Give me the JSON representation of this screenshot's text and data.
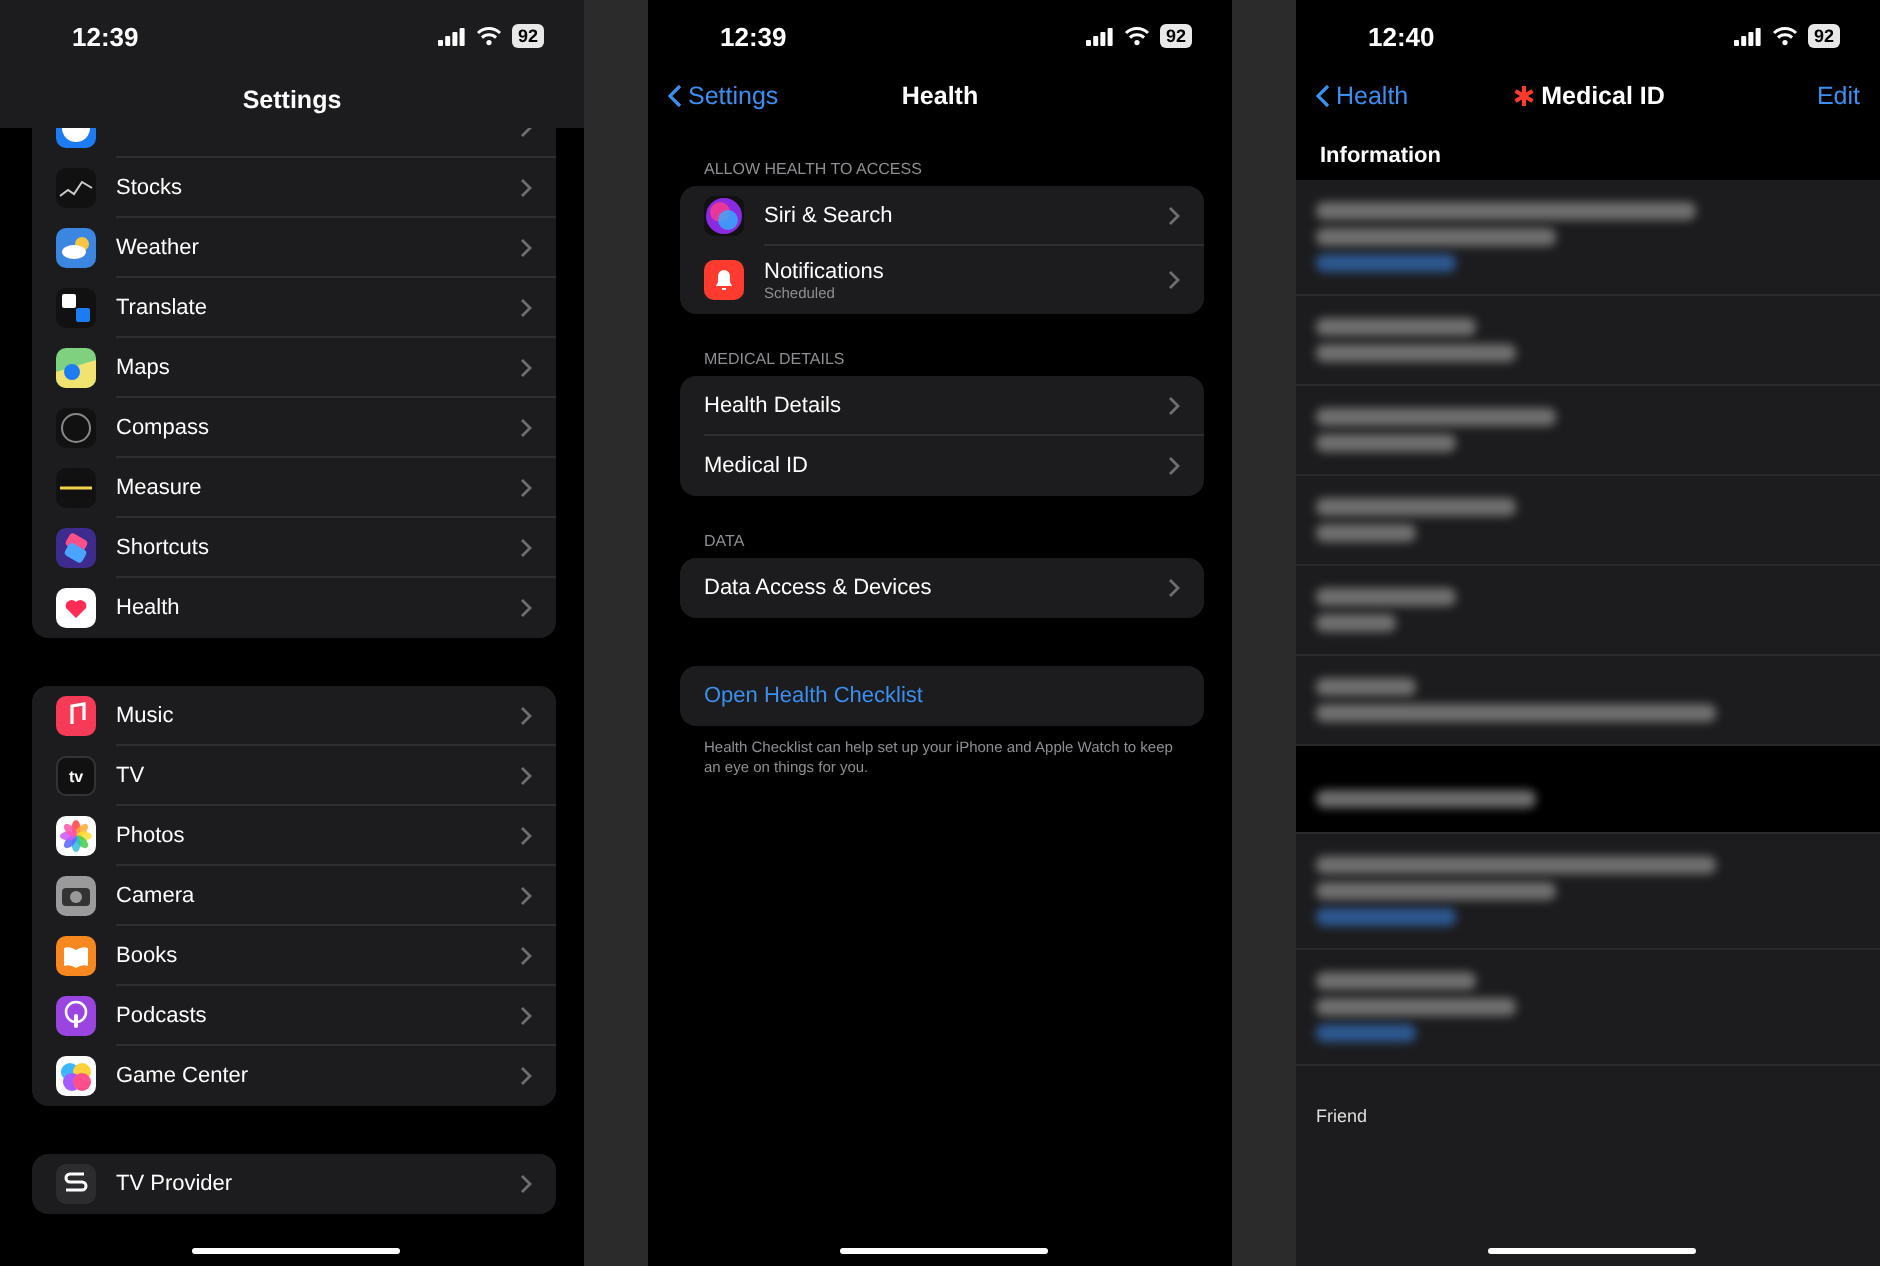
{
  "screens": [
    {
      "kind": "settings",
      "status": {
        "time": "12:39",
        "battery": "92"
      },
      "title": "Settings",
      "groups": [
        [
          {
            "kind": "safari"
          },
          {
            "label": "Stocks",
            "kind": "stocks"
          },
          {
            "label": "Weather",
            "kind": "weather"
          },
          {
            "label": "Translate",
            "kind": "translate"
          },
          {
            "label": "Maps",
            "kind": "maps"
          },
          {
            "label": "Compass",
            "kind": "compass"
          },
          {
            "label": "Measure",
            "kind": "measure"
          },
          {
            "label": "Shortcuts",
            "kind": "shortcuts"
          },
          {
            "label": "Health",
            "kind": "health"
          }
        ],
        [
          {
            "label": "Music",
            "kind": "music"
          },
          {
            "label": "TV",
            "kind": "tv",
            "icon_text": "tv"
          },
          {
            "label": "Photos",
            "kind": "photos"
          },
          {
            "label": "Camera",
            "kind": "camera"
          },
          {
            "label": "Books",
            "kind": "books"
          },
          {
            "label": "Podcasts",
            "kind": "podcasts"
          },
          {
            "label": "Game Center",
            "kind": "gamecenter"
          }
        ],
        [
          {
            "label": "TV Provider",
            "kind": "tvprovider"
          }
        ]
      ]
    },
    {
      "kind": "health",
      "status": {
        "time": "12:39",
        "battery": "92"
      },
      "back": "Settings",
      "title": "Health",
      "sections": [
        {
          "header": "ALLOW HEALTH TO ACCESS",
          "rows": [
            {
              "label": "Siri & Search",
              "kind": "siri"
            },
            {
              "label": "Notifications",
              "subtitle": "Scheduled",
              "kind": "notifications"
            }
          ]
        },
        {
          "header": "MEDICAL DETAILS",
          "rows": [
            {
              "label": "Health Details"
            },
            {
              "label": "Medical ID"
            }
          ]
        },
        {
          "header": "DATA",
          "rows": [
            {
              "label": "Data Access & Devices"
            }
          ]
        }
      ],
      "checklist": {
        "link": "Open Health Checklist",
        "footer": "Health Checklist can help set up your iPhone and Apple Watch to keep an eye on things for you."
      }
    },
    {
      "kind": "medical",
      "status": {
        "time": "12:40",
        "battery": "92"
      },
      "back": "Health",
      "title": "Medical ID",
      "action": "Edit",
      "section": "Information",
      "blocks": [
        {
          "kind": "row",
          "lines": [
            {
              "kind": "plain"
            },
            {
              "kind": "plain"
            },
            {
              "kind": "link"
            }
          ]
        },
        {
          "kind": "row",
          "lines": [
            {
              "kind": "plain"
            },
            {
              "kind": "plain"
            }
          ]
        },
        {
          "kind": "row",
          "lines": [
            {
              "kind": "plain"
            },
            {
              "kind": "plain"
            }
          ]
        },
        {
          "kind": "row",
          "lines": [
            {
              "kind": "plain"
            },
            {
              "kind": "plain"
            }
          ]
        },
        {
          "kind": "row",
          "lines": [
            {
              "kind": "plain"
            },
            {
              "kind": "plain"
            }
          ]
        },
        {
          "kind": "row",
          "lines": [
            {
              "kind": "plain"
            },
            {
              "kind": "plain"
            }
          ]
        },
        {
          "kind": "band",
          "lines": [
            {
              "kind": "plain"
            }
          ]
        },
        {
          "kind": "row",
          "lines": [
            {
              "kind": "plain"
            },
            {
              "kind": "plain"
            },
            {
              "kind": "link"
            }
          ]
        },
        {
          "kind": "row",
          "lines": [
            {
              "kind": "plain"
            },
            {
              "kind": "plain"
            },
            {
              "kind": "link"
            }
          ]
        }
      ],
      "footer": "Friend"
    }
  ]
}
